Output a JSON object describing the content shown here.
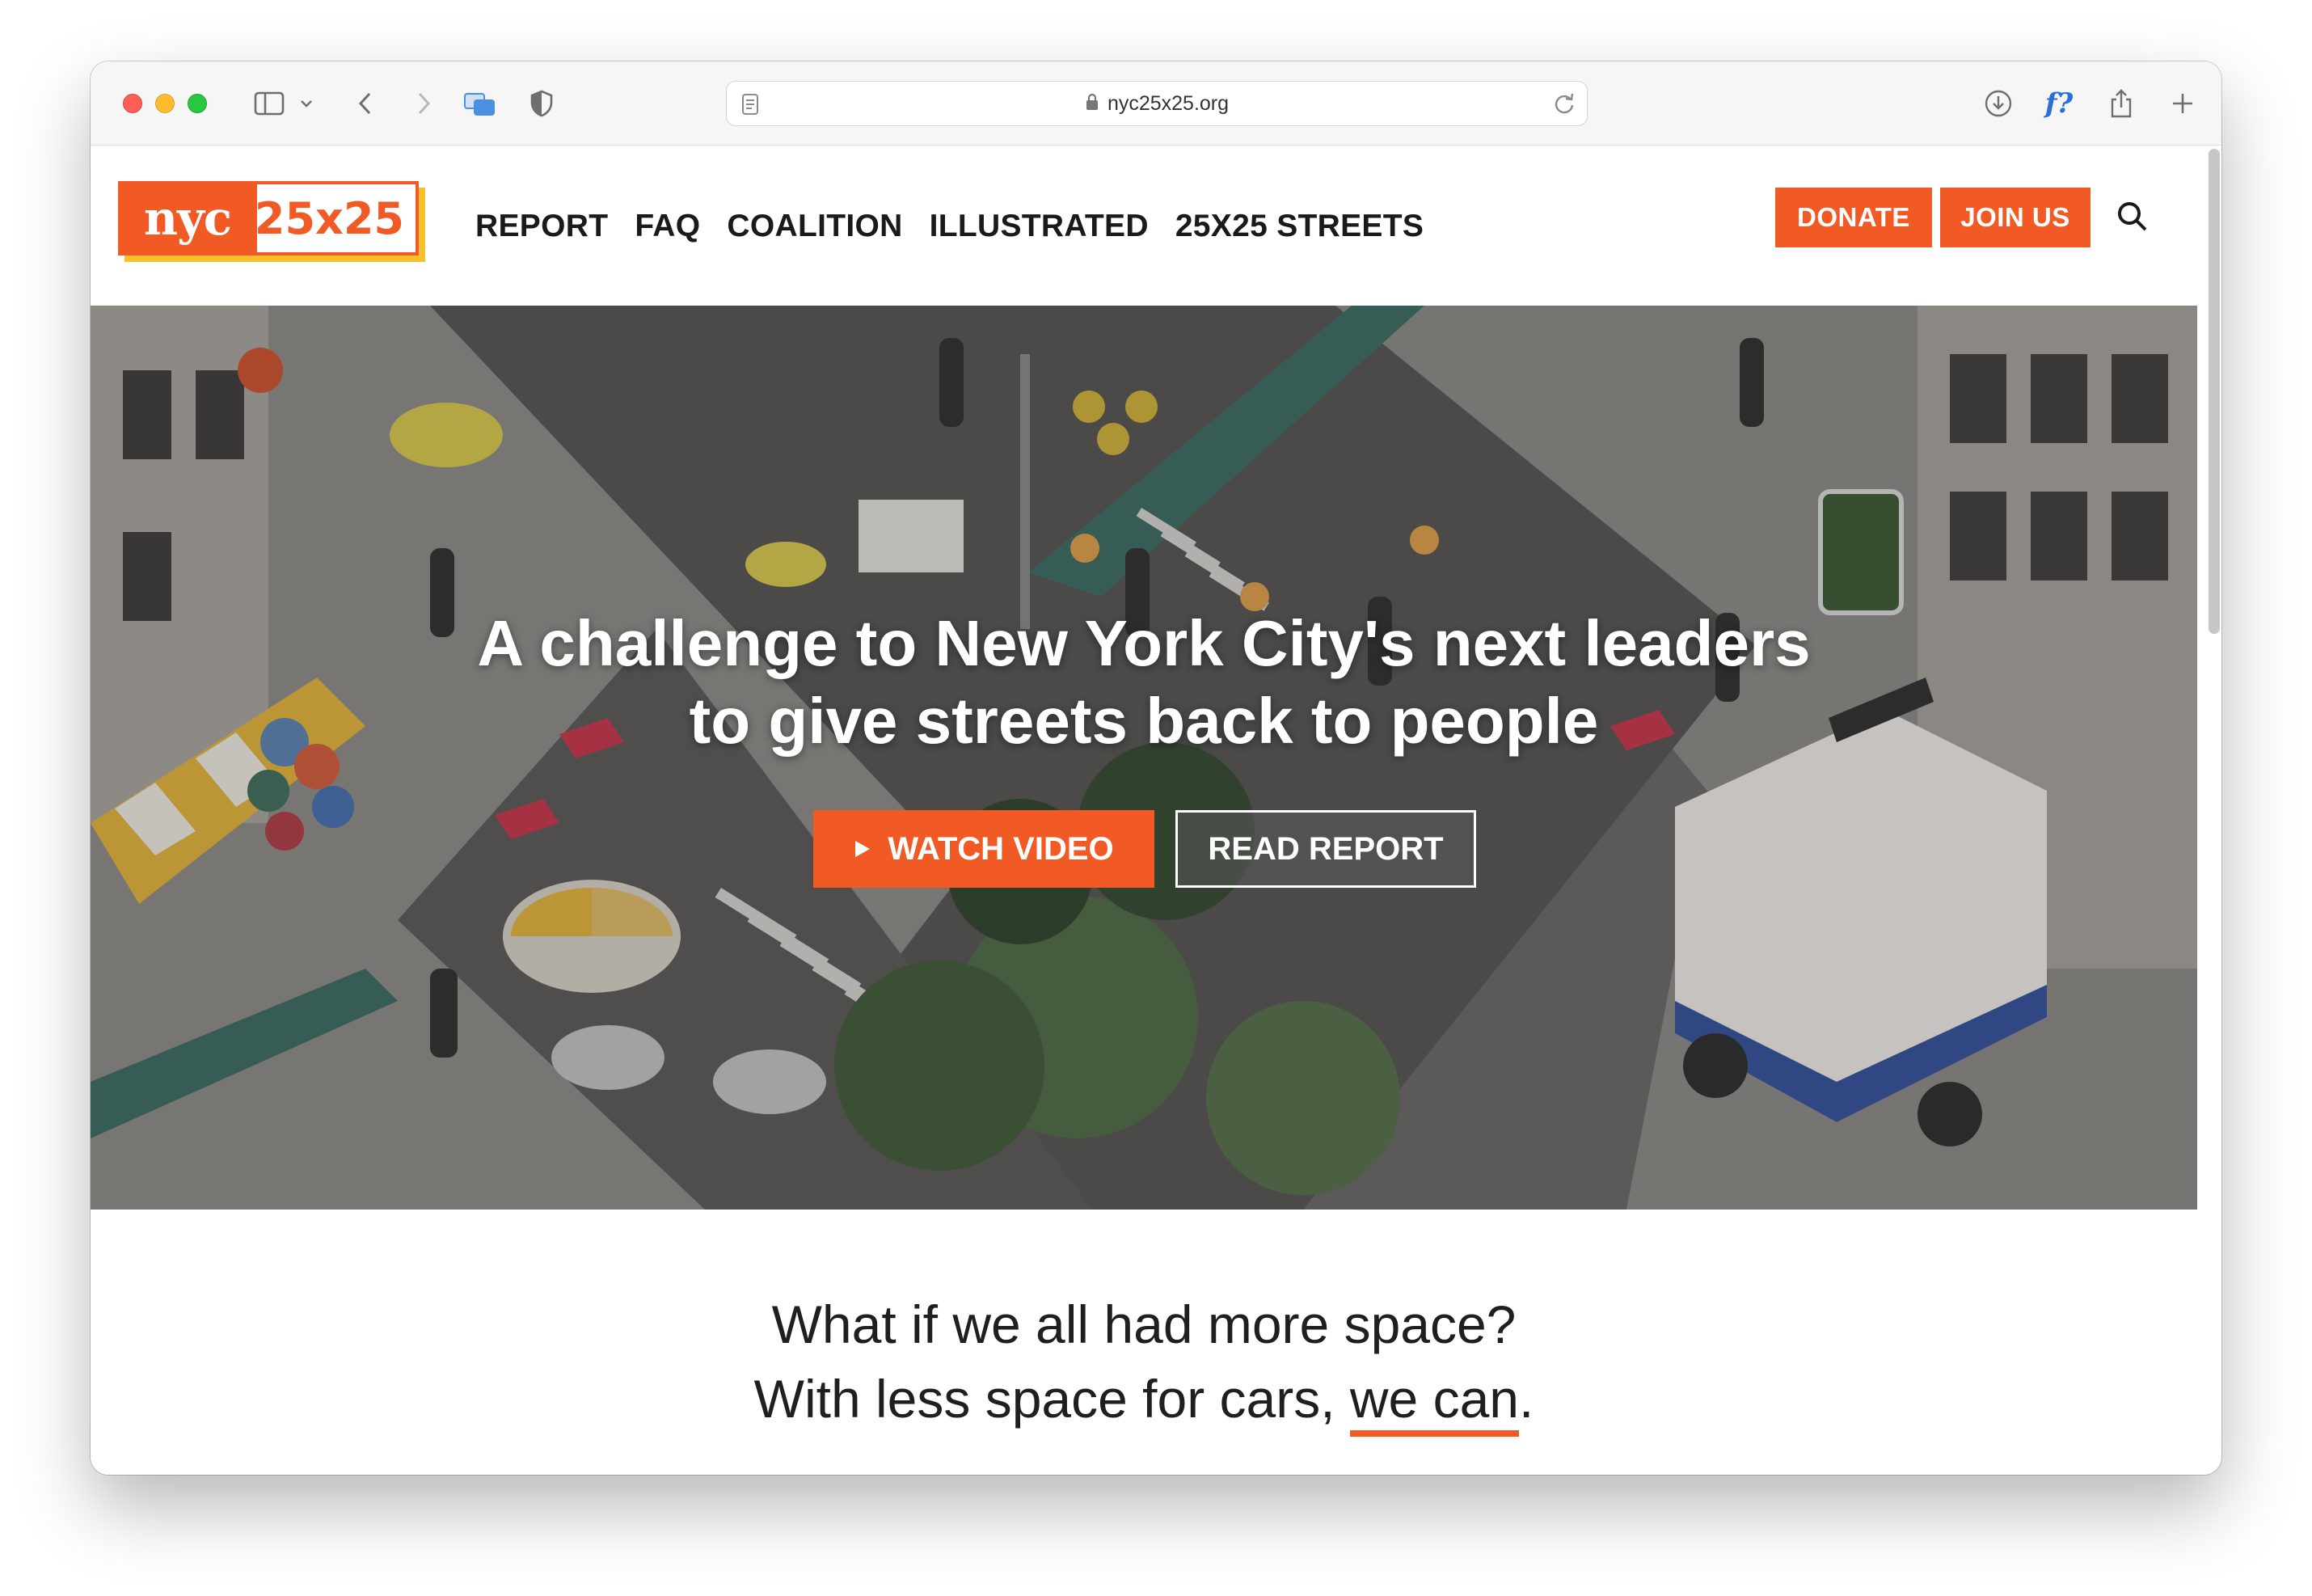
{
  "browser": {
    "url": "nyc25x25.org"
  },
  "site": {
    "logo": {
      "left": "nyc",
      "right": "25x25"
    },
    "nav": [
      "REPORT",
      "FAQ",
      "COALITION",
      "ILLUSTRATED",
      "25X25 STREETS"
    ],
    "donate_label": "DONATE",
    "join_label": "JOIN US"
  },
  "hero": {
    "title_line1": "A challenge to New York City's next leaders",
    "title_line2": "to give streets back to people",
    "watch_label": "WATCH VIDEO",
    "read_label": "READ REPORT"
  },
  "tagline": {
    "line1": "What if we all had more space?",
    "line2_prefix": "With less space for cars, ",
    "line2_emphasis": "we can",
    "line2_suffix": "."
  },
  "colors": {
    "accent": "#f15a24",
    "logo_shadow": "#f6c12d"
  }
}
